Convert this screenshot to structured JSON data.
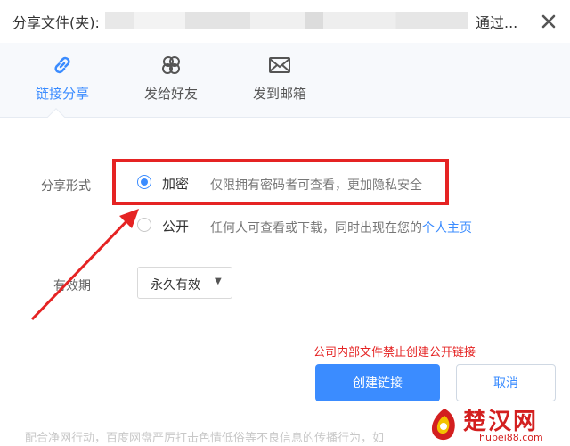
{
  "dialog": {
    "title_prefix": "分享文件(夹):",
    "title_suffix": "通过...",
    "close_icon": "close-icon"
  },
  "tabs": [
    {
      "label": "链接分享",
      "icon": "link-icon",
      "active": true
    },
    {
      "label": "发给好友",
      "icon": "friends-icon",
      "active": false
    },
    {
      "label": "发到邮箱",
      "icon": "mail-icon",
      "active": false
    }
  ],
  "share_form": {
    "label": "分享形式",
    "options": [
      {
        "name": "加密",
        "desc": "仅限拥有密码者可查看，更加隐私安全",
        "checked": true
      },
      {
        "name": "公开",
        "desc": "任何人可查看或下载，同时出现在您的",
        "link": "个人主页",
        "checked": false
      }
    ]
  },
  "validity": {
    "label": "有效期",
    "selected": "永久有效"
  },
  "warning": "公司内部文件禁止创建公开链接",
  "buttons": {
    "create": "创建链接",
    "cancel": "取消"
  },
  "footer_notice": "配合净网行动，百度网盘严厉打击色情低俗等不良信息的传播行为，如",
  "watermark": {
    "name": "楚汉网",
    "url": "hubei88.com"
  },
  "colors": {
    "accent": "#3b8cff",
    "annotation_red": "#e52323"
  }
}
